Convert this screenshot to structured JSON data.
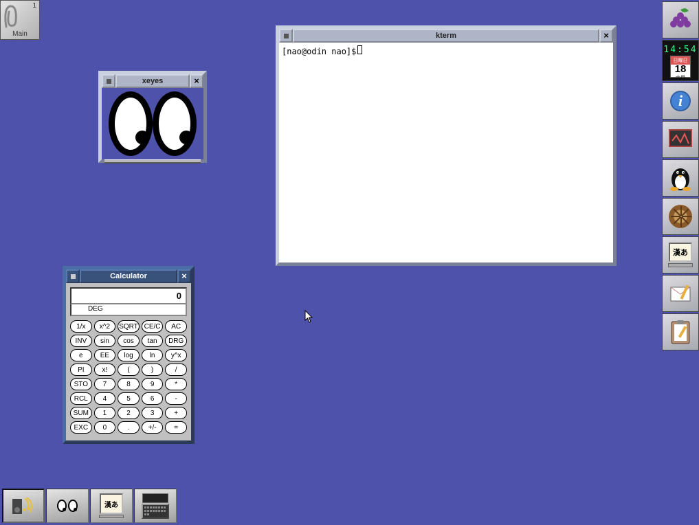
{
  "pager": {
    "number": "1",
    "label": "Main"
  },
  "dock": {
    "clock_time": "14:54",
    "calendar": {
      "top": "日曜日",
      "day": "18",
      "bottom": "六月"
    },
    "ime_label": "漢あ"
  },
  "windows": {
    "kterm": {
      "title": "kterm",
      "prompt": "[nao@odin nao]$"
    },
    "xeyes": {
      "title": "xeyes"
    },
    "calculator": {
      "title": "Calculator",
      "display": "0",
      "mode": "DEG",
      "keys": [
        "1/x",
        "x^2",
        "SQRT",
        "CE/C",
        "AC",
        "INV",
        "sin",
        "cos",
        "tan",
        "DRG",
        "e",
        "EE",
        "log",
        "ln",
        "y^x",
        "PI",
        "x!",
        "(",
        ")",
        "/",
        "STO",
        "7",
        "8",
        "9",
        "*",
        "RCL",
        "4",
        "5",
        "6",
        "-",
        "SUM",
        "1",
        "2",
        "3",
        "+",
        "EXC",
        "0",
        ".",
        "+/-",
        "="
      ]
    }
  },
  "taskbar": {
    "ime_label": "漢あ"
  }
}
